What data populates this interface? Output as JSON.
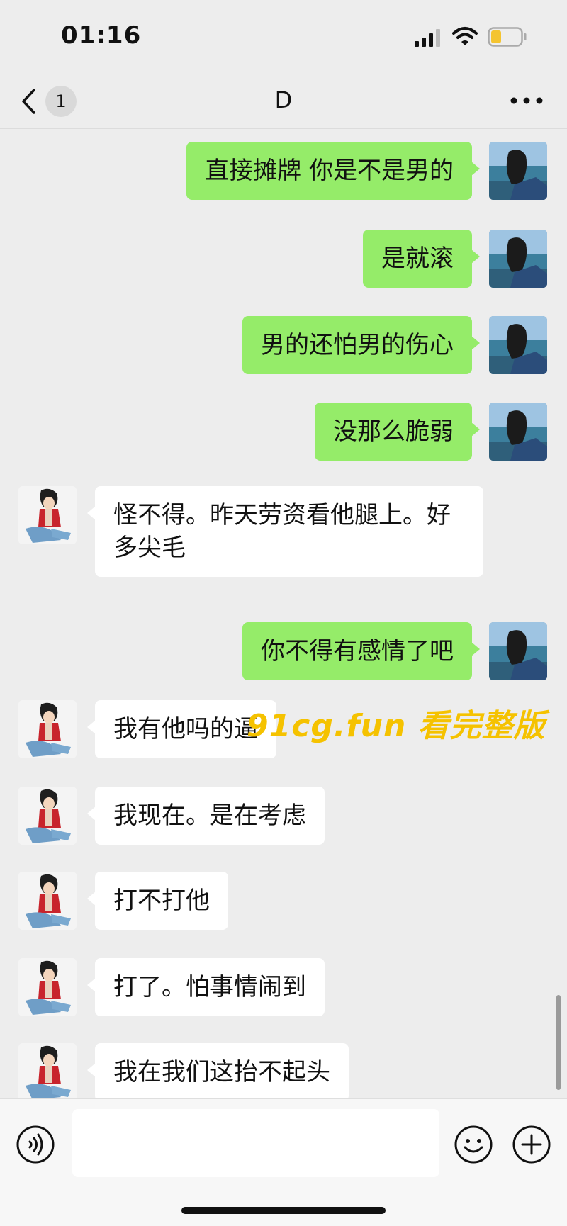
{
  "status_bar": {
    "time": "01:16"
  },
  "nav": {
    "unread_count": "1",
    "title": "D"
  },
  "messages": [
    {
      "from": "me",
      "text": "直接摊牌 你是不是男的"
    },
    {
      "from": "me",
      "text": "是就滚"
    },
    {
      "from": "me",
      "text": "男的还怕男的伤心"
    },
    {
      "from": "me",
      "text": "没那么脆弱"
    },
    {
      "from": "them",
      "text": "怪不得。昨天劳资看他腿上。好多尖毛"
    },
    {
      "from": "me",
      "text": "你不得有感情了吧"
    },
    {
      "from": "them",
      "text": "我有他吗的逼"
    },
    {
      "from": "them",
      "text": "我现在。是在考虑"
    },
    {
      "from": "them",
      "text": "打不打他"
    },
    {
      "from": "them",
      "text": "打了。怕事情闹到"
    },
    {
      "from": "them",
      "text": "我在我们这抬不起头"
    }
  ],
  "watermark": "91cg.fun 看完整版",
  "colors": {
    "me_bubble": "#95ec69",
    "them_bubble": "#ffffff",
    "background": "#ededed",
    "watermark": "#f5c200"
  },
  "icons": [
    "back-chevron-icon",
    "more-dots-icon",
    "voice-icon",
    "emoji-icon",
    "plus-icon",
    "signal-icon",
    "wifi-icon",
    "battery-icon"
  ]
}
